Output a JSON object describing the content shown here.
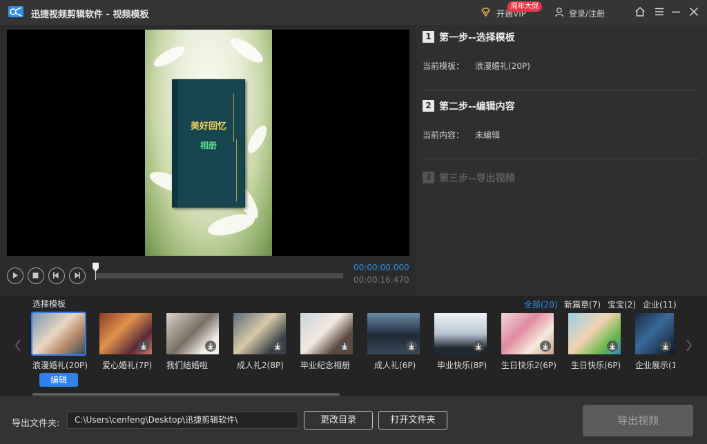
{
  "titlebar": {
    "title": "迅捷视频剪辑软件 - 视频模板",
    "vip_label": "开通VIP",
    "promo_badge": "周年大促",
    "login_label": "登录/注册"
  },
  "player": {
    "current_time": "00:00:00.000",
    "total_time": "00:00:16.470",
    "progress": 0,
    "preview_text": {
      "line1": "美好回忆",
      "line2": "相册"
    }
  },
  "steps": [
    {
      "num": "1",
      "title": "第一步--选择模板",
      "label": "当前模板：",
      "value": "浪漫婚礼(20P)",
      "enabled": true
    },
    {
      "num": "2",
      "title": "第二步--编辑内容",
      "label": "当前内容：",
      "value": "未编辑",
      "enabled": true
    },
    {
      "num": "3",
      "title": "第三步--导出视频",
      "enabled": false
    }
  ],
  "templates": {
    "section_title": "选择模板",
    "categories": [
      {
        "label": "全部(20)",
        "active": true
      },
      {
        "label": "新篇章(7)",
        "active": false
      },
      {
        "label": "宝宝(2)",
        "active": false
      },
      {
        "label": "企业(11)",
        "active": false
      }
    ],
    "items": [
      {
        "label": "浪漫婚礼(20P)",
        "selected": true,
        "downloadable": false
      },
      {
        "label": "爱心婚礼(7P)",
        "selected": false,
        "downloadable": true
      },
      {
        "label": "我们结婚啦",
        "selected": false,
        "downloadable": true
      },
      {
        "label": "成人礼2(8P)",
        "selected": false,
        "downloadable": true
      },
      {
        "label": "毕业纪念相册",
        "selected": false,
        "downloadable": true
      },
      {
        "label": "成人礼(6P)",
        "selected": false,
        "downloadable": true
      },
      {
        "label": "毕业快乐(8P)",
        "selected": false,
        "downloadable": true
      },
      {
        "label": "生日快乐2(6P)",
        "selected": false,
        "downloadable": true
      },
      {
        "label": "生日快乐(6P)",
        "selected": false,
        "downloadable": true
      },
      {
        "label": "企业展示(1",
        "selected": false,
        "downloadable": true
      }
    ],
    "edit_label": "编辑"
  },
  "bottom": {
    "output_label": "导出文件夹:",
    "output_path": "C:\\Users\\cenfeng\\Desktop\\迅捷剪辑软件\\",
    "change_dir_label": "更改目录",
    "open_folder_label": "打开文件夹",
    "export_label": "导出视频"
  },
  "colors": {
    "accent": "#2e8fe8",
    "promo": "#e8374a",
    "vip_gold": "#e3b34a"
  }
}
